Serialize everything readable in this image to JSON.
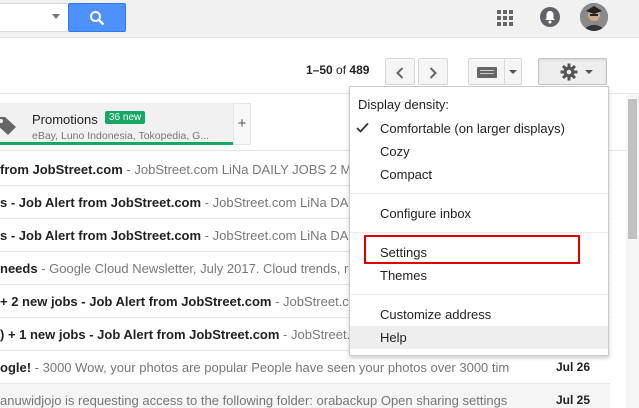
{
  "header": {
    "search_icon": "search-icon",
    "apps_icon": "apps-grid-icon",
    "notifications_icon": "bell-icon"
  },
  "toolbar": {
    "page_range": "1–50",
    "page_of": "of",
    "page_total": "489"
  },
  "tabs": {
    "promotions_label": "Promotions",
    "promotions_badge": "36 new",
    "promotions_senders": "eBay, Luno Indonesia, Tokopedia, G...",
    "add_tab_label": "+"
  },
  "emails": [
    {
      "subject": "from JobStreet.com",
      "snippet": " - JobStreet.com LiNa DAILY JOBS 2 Matches",
      "date": "",
      "read": false
    },
    {
      "subject": "s - Job Alert from JobStreet.com",
      "snippet": " - JobStreet.com LiNa DAILY JOBS",
      "date": "",
      "read": false
    },
    {
      "subject": "s - Job Alert from JobStreet.com",
      "snippet": " - JobStreet.com LiNa DAILY JOBS",
      "date": "",
      "read": false
    },
    {
      "subject": "needs",
      "snippet": " - Google Cloud Newsletter, July 2017. Cloud trends, re",
      "date": "",
      "read": false
    },
    {
      "subject": "+ 2 new jobs - Job Alert from JobStreet.com",
      "snippet": " - JobStreet.com",
      "date": "",
      "read": false
    },
    {
      "subject": ") + 1 new jobs - Job Alert from JobStreet.com",
      "snippet": " - JobStreet.c",
      "date": "",
      "read": false
    },
    {
      "subject": "ogle!",
      "snippet": " - 3000 Wow, your photos are popular People have seen your photos over 3000 time",
      "date": "Jul 26",
      "read": false
    },
    {
      "subject": "",
      "snippet": "anuwidjojo is requesting access to the following folder: orabackup Open sharing settings G",
      "date": "Jul 25",
      "read": true
    }
  ],
  "menu": {
    "heading": "Display density:",
    "density_options": [
      "Comfortable (on larger displays)",
      "Cozy",
      "Compact"
    ],
    "selected_density": "Comfortable (on larger displays)",
    "configure_inbox": "Configure inbox",
    "settings": "Settings",
    "themes": "Themes",
    "customize_address": "Customize address",
    "help": "Help"
  },
  "colors": {
    "search_blue": "#4d90fe",
    "promo_green": "#16a765",
    "highlight_red": "#e00000"
  }
}
